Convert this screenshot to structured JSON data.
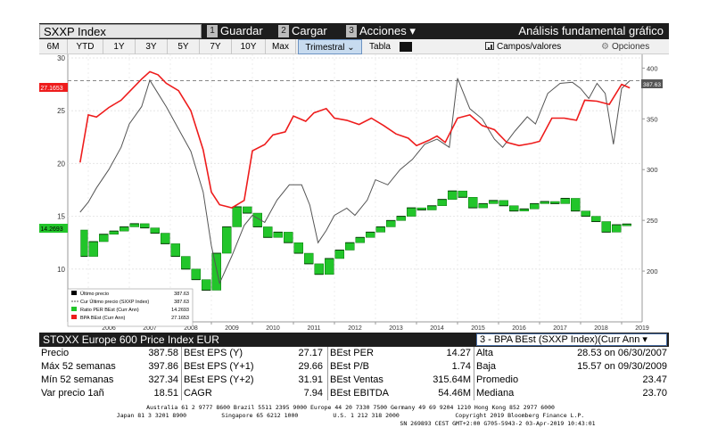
{
  "title_bar": {
    "ticker": "SXXP Index",
    "buttons": [
      {
        "num": "1",
        "label": "Guardar"
      },
      {
        "num": "2",
        "label": "Cargar"
      },
      {
        "num": "3",
        "label": "Acciones ▾"
      }
    ],
    "function_title": "Análisis fundamental gráfico"
  },
  "period_bar": {
    "periods": [
      "6M",
      "YTD",
      "1Y",
      "3Y",
      "5Y",
      "7Y",
      "10Y",
      "Max"
    ],
    "frequency": "Trimestral ⌄",
    "table_label": "Tabla",
    "fields_label": "Campos/valores",
    "options_label": "Opciones"
  },
  "chart_data": {
    "type": "line",
    "x_labels": [
      "2006",
      "2007",
      "2008",
      "2009",
      "2010",
      "2011",
      "2012",
      "2013",
      "2014",
      "2015",
      "2016",
      "2017",
      "2018",
      "2019"
    ],
    "left_axis": {
      "ticks": [
        "30",
        "25",
        "20",
        "15",
        "10"
      ],
      "ylim": [
        5,
        30
      ]
    },
    "right_axis": {
      "ticks": [
        "400",
        "350",
        "300",
        "250",
        "200"
      ],
      "ylim": [
        150,
        410
      ]
    },
    "last_price_marker": "387.63",
    "bpa_marker": "27.1653",
    "per_marker": "14.2693",
    "reference_level": 387.63,
    "price": {
      "name": "Cur Último precio (SXXP Index)",
      "t": [
        2005.8,
        2006.0,
        2006.2,
        2006.5,
        2006.8,
        2007.0,
        2007.3,
        2007.5,
        2007.7,
        2007.9,
        2008.2,
        2008.5,
        2008.8,
        2009.0,
        2009.2,
        2009.5,
        2009.8,
        2010.0,
        2010.3,
        2010.6,
        2010.9,
        2011.2,
        2011.4,
        2011.6,
        2011.8,
        2012.0,
        2012.3,
        2012.5,
        2012.8,
        2013.0,
        2013.3,
        2013.6,
        2013.9,
        2014.2,
        2014.5,
        2014.8,
        2015.0,
        2015.3,
        2015.6,
        2015.9,
        2016.1,
        2016.4,
        2016.7,
        2016.9,
        2017.2,
        2017.5,
        2017.8,
        2018.0,
        2018.2,
        2018.4,
        2018.6,
        2018.8,
        2019.0,
        2019.2
      ],
      "v": [
        258,
        268,
        282,
        300,
        322,
        345,
        362,
        388,
        375,
        362,
        340,
        318,
        278,
        225,
        188,
        215,
        245,
        255,
        248,
        270,
        285,
        285,
        265,
        228,
        240,
        255,
        262,
        255,
        270,
        290,
        285,
        300,
        310,
        325,
        330,
        322,
        390,
        360,
        350,
        330,
        322,
        338,
        352,
        345,
        375,
        385,
        386,
        380,
        370,
        385,
        375,
        325,
        380,
        387.63
      ]
    },
    "bpa": {
      "name": "BPA BEst (Curr Ann)",
      "t": [
        2005.8,
        2006.0,
        2006.2,
        2006.5,
        2006.8,
        2007.0,
        2007.3,
        2007.5,
        2007.7,
        2007.9,
        2008.2,
        2008.5,
        2008.8,
        2009.0,
        2009.2,
        2009.5,
        2009.8,
        2010.0,
        2010.3,
        2010.5,
        2010.8,
        2011.0,
        2011.3,
        2011.5,
        2011.8,
        2012.0,
        2012.3,
        2012.6,
        2012.9,
        2013.2,
        2013.5,
        2013.8,
        2014.0,
        2014.3,
        2014.5,
        2014.7,
        2015.0,
        2015.3,
        2015.6,
        2015.9,
        2016.2,
        2016.5,
        2016.8,
        2017.0,
        2017.3,
        2017.6,
        2017.9,
        2018.1,
        2018.4,
        2018.7,
        2019.0,
        2019.2
      ],
      "v": [
        20.1,
        24.6,
        24.4,
        25.3,
        26.0,
        26.8,
        28.0,
        28.7,
        28.4,
        27.6,
        26.9,
        25.0,
        21.3,
        17.3,
        16.1,
        15.8,
        16.5,
        21.2,
        21.8,
        22.7,
        23.0,
        24.5,
        24.0,
        24.8,
        25.2,
        24.3,
        24.1,
        23.7,
        24.3,
        23.6,
        22.8,
        22.4,
        21.7,
        22.2,
        22.6,
        22.0,
        24.3,
        24.6,
        23.6,
        23.2,
        22.0,
        21.7,
        21.9,
        22.1,
        24.3,
        24.3,
        24.1,
        26.0,
        25.9,
        25.6,
        27.5,
        27.1653
      ]
    },
    "per": {
      "name": "Ratio PER BEst (Curr Ann)",
      "t": [
        2005.8,
        2006.0,
        2006.25,
        2006.5,
        2006.75,
        2007.0,
        2007.25,
        2007.5,
        2007.75,
        2008.0,
        2008.25,
        2008.5,
        2008.75,
        2009.0,
        2009.25,
        2009.5,
        2009.75,
        2010.0,
        2010.25,
        2010.5,
        2010.75,
        2011.0,
        2011.25,
        2011.5,
        2011.75,
        2012.0,
        2012.25,
        2012.5,
        2012.75,
        2013.0,
        2013.25,
        2013.5,
        2013.75,
        2014.0,
        2014.25,
        2014.5,
        2014.75,
        2015.0,
        2015.25,
        2015.5,
        2015.75,
        2016.0,
        2016.25,
        2016.5,
        2016.75,
        2017.0,
        2017.25,
        2017.5,
        2017.75,
        2018.0,
        2018.25,
        2018.5,
        2018.75,
        2019.0,
        2019.25
      ],
      "v": [
        13.7,
        11.2,
        12.6,
        13.3,
        13.6,
        14.0,
        14.3,
        13.9,
        13.4,
        12.4,
        11.2,
        10.0,
        9.0,
        8.0,
        11.5,
        14.0,
        15.9,
        15.3,
        14.0,
        13.0,
        13.5,
        12.5,
        11.5,
        10.5,
        9.5,
        11.0,
        11.8,
        12.5,
        13.0,
        13.5,
        14.0,
        14.6,
        15.0,
        15.8,
        15.6,
        16.0,
        16.6,
        17.4,
        16.8,
        15.8,
        16.2,
        16.5,
        16.0,
        15.5,
        15.7,
        16.2,
        16.4,
        16.2,
        16.7,
        15.5,
        15.0,
        14.5,
        13.5,
        14.2,
        14.2693
      ]
    },
    "legend": [
      {
        "label": "Último precio",
        "value": "387.63",
        "color": "#000000"
      },
      {
        "label": "Cur Último precio (SXXP Index)",
        "value": "387.63",
        "color": "#555555"
      },
      {
        "label": "Ratio PER BEst (Curr Ann)",
        "value": "14.2693",
        "color": "#22c52a"
      },
      {
        "label": "BPA BEst (Curr Ann)",
        "value": "27.1653",
        "color": "#ee1c1c"
      }
    ],
    "colors": {
      "bpa": "#ee1c1c",
      "price": "#555555",
      "per": "#22c52a",
      "per_dark": "#0c7a0f"
    }
  },
  "stats": {
    "header": "STOXX Europe 600 Price Index EUR",
    "selector": "3 - BPA BEst (SXXP Index)(Curr Ann ▾",
    "rows": [
      {
        "l1": "Precio",
        "v1": "387.58",
        "l2": "BEst EPS (Y)",
        "v2": "27.17",
        "l3": "BEst PER",
        "v3": "14.27",
        "l4": "Alta",
        "v4": "28.53 on 06/30/2007"
      },
      {
        "l1": "Máx 52 semanas",
        "v1": "397.86",
        "l2": "BEst EPS (Y+1)",
        "v2": "29.66",
        "l3": "BEst P/B",
        "v3": "1.74",
        "l4": "Baja",
        "v4": "15.57 on 09/30/2009"
      },
      {
        "l1": "Mín 52 semanas",
        "v1": "327.34",
        "l2": "BEst EPS (Y+2)",
        "v2": "31.91",
        "l3": "BEst Ventas",
        "v3": "315.64M",
        "l4": "Promedio",
        "v4": "23.47"
      },
      {
        "l1": "Var precio 1añ",
        "v1": "18.51",
        "l2": "CAGR",
        "v2": "7.94",
        "l3": "BEst EBITDA",
        "v3": "54.46M",
        "l4": "Mediana",
        "v4": "23.70"
      }
    ]
  },
  "footer": {
    "line1": "Australia 61 2 9777 8600 Brazil 5511 2395 9000 Europe 44 20 7330 7500 Germany 49 69 9204 1210 Hong Kong 852 2977 6000",
    "line2": "Japan 81 3 3201 8900          Singapore 65 6212 1000          U.S. 1 212 318 2000                Copyright 2019 Bloomberg Finance L.P.",
    "line3": "SN 269893 CEST GMT+2:00 G705-5943-2 03-Apr-2019 10:43:01"
  }
}
